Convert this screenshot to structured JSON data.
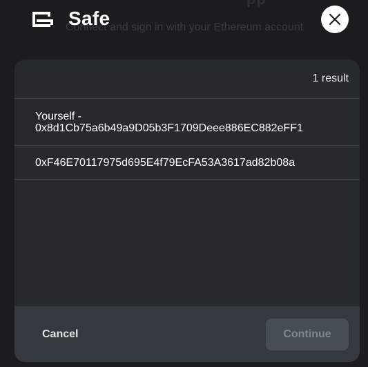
{
  "background": {
    "title": "Sign In With Ethereum App",
    "subtitle": "Connect and sign in with your Ethereum account"
  },
  "brand": {
    "name": "Safe",
    "icon": "safe-logo-icon"
  },
  "close_icon": "close-icon",
  "results": {
    "count_label": "1 result"
  },
  "accounts": [
    {
      "label": "Yourself -",
      "address": "0x8d1Cb75a6b49a9D05b3F1709Deee886EC882eFF1"
    },
    {
      "label": "",
      "address": "0xF46E70117975d695E4f79EcFA53A3617ad82b08a"
    }
  ],
  "footer": {
    "cancel_label": "Cancel",
    "continue_label": "Continue"
  },
  "colors": {
    "overlay_background": "#1c1c1f",
    "modal_background": "#262a2d",
    "footer_background": "#33393e",
    "continue_disabled_background": "#464d53",
    "continue_disabled_text": "#7f878d",
    "close_button_background": "#ffffff"
  }
}
